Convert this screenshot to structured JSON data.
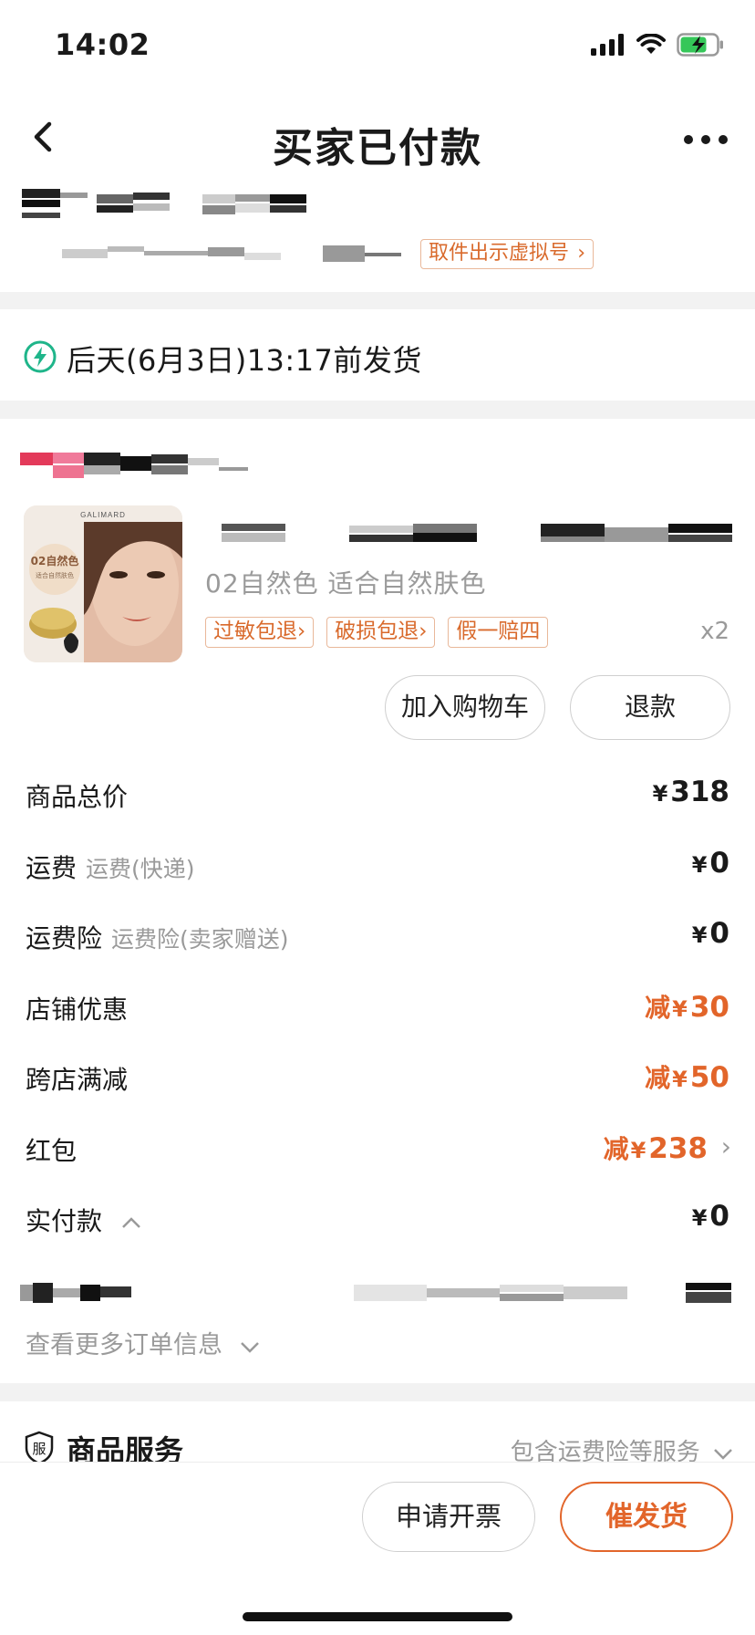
{
  "status_bar": {
    "time": "14:02"
  },
  "nav": {
    "title": "买家已付款"
  },
  "address": {
    "virtual_number_button": "取件出示虚拟号"
  },
  "shipping": {
    "text": "后天(6月3日)13:17前发货"
  },
  "product": {
    "image_brand": "GALIMARD",
    "image_shade": "02自然色",
    "image_caption": "适合自然肤色",
    "spec": "02自然色 适合自然肤色",
    "tags": [
      "过敏包退",
      "破损包退",
      "假一赔四"
    ],
    "quantity": "x2"
  },
  "actions": {
    "add_to_cart": "加入购物车",
    "refund": "退款"
  },
  "price_rows": [
    {
      "label": "商品总价",
      "sub": "",
      "prefix": "",
      "currency": "¥",
      "value": "318"
    },
    {
      "label": "运费",
      "sub": "运费(快递)",
      "prefix": "",
      "currency": "¥",
      "value": "0"
    },
    {
      "label": "运费险",
      "sub": "运费险(卖家赠送)",
      "prefix": "",
      "currency": "¥",
      "value": "0"
    },
    {
      "label": "店铺优惠",
      "sub": "",
      "prefix": "减",
      "currency": "¥",
      "value": "30"
    },
    {
      "label": "跨店满减",
      "sub": "",
      "prefix": "减",
      "currency": "¥",
      "value": "50"
    },
    {
      "label": "红包",
      "sub": "",
      "prefix": "减",
      "currency": "¥",
      "value": "238"
    },
    {
      "label": "实付款",
      "sub": "",
      "prefix": "",
      "currency": "¥",
      "value": "0"
    }
  ],
  "more_info": "查看更多订单信息",
  "service": {
    "title": "商品服务",
    "icon_char": "服",
    "note": "包含运费险等服务"
  },
  "bottom": {
    "invoice": "申请开票",
    "urge": "催发货"
  },
  "colors": {
    "accent": "#e2652a",
    "tag_border": "#e9b89a",
    "ship_icon": "#1fb58a"
  }
}
